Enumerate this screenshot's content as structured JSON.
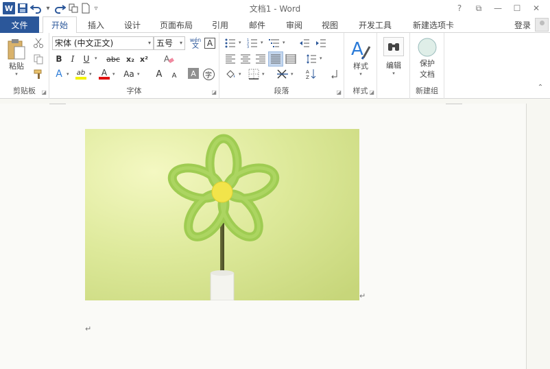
{
  "window": {
    "title": "文档1 - Word",
    "controls": [
      "?",
      "⧉",
      "—",
      "☐",
      "✕"
    ]
  },
  "qat": {
    "logo": "W"
  },
  "tabs": {
    "file": "文件",
    "items": [
      "开始",
      "插入",
      "设计",
      "页面布局",
      "引用",
      "邮件",
      "审阅",
      "视图",
      "开发工具",
      "新建选项卡"
    ],
    "active_index": 0,
    "login": "登录"
  },
  "ribbon": {
    "clipboard": {
      "label": "剪贴板",
      "paste": "粘贴"
    },
    "font": {
      "label": "字体",
      "font_name": "宋体 (中文正文)",
      "font_size": "五号",
      "wen": "wén",
      "wen_char": "文",
      "border_char": "A",
      "bold": "B",
      "italic": "I",
      "underline": "U",
      "strike": "abc",
      "subscript": "x₂",
      "superscript": "x²",
      "effects": "A",
      "highlight": "ab",
      "font_color": "A",
      "case": "Aa",
      "grow": "A",
      "shrink": "A",
      "shade_char": "A",
      "circle_char": "字"
    },
    "paragraph": {
      "label": "段落"
    },
    "styles": {
      "label": "样式",
      "button": "样式"
    },
    "editing": {
      "button": "编辑"
    },
    "protect": {
      "label": "新建组",
      "button_line1": "保护",
      "button_line2": "文档"
    }
  },
  "document": {
    "para_mark": "↵"
  }
}
